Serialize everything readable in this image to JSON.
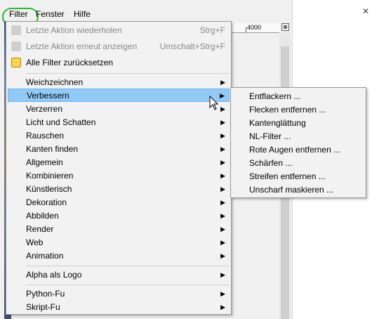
{
  "menubar": {
    "items": [
      {
        "label": "Filter"
      },
      {
        "label": "Fenster"
      },
      {
        "label": "Hilfe"
      }
    ],
    "highlight_color": "#22bb33"
  },
  "ruler": {
    "label": "4000"
  },
  "menu": {
    "top_items": [
      {
        "label": "Letzte Aktion wiederholen",
        "shortcut": "Strg+F",
        "disabled": true
      },
      {
        "label": "Letzte Aktion erneut anzeigen",
        "shortcut": "Umschalt+Strg+F",
        "disabled": true
      },
      {
        "label": "Alle Filter zurücksetzen",
        "shortcut": "",
        "disabled": false
      }
    ],
    "categories": [
      {
        "label": "Weichzeichnen"
      },
      {
        "label": "Verbessern"
      },
      {
        "label": "Verzerren"
      },
      {
        "label": "Licht und Schatten"
      },
      {
        "label": "Rauschen"
      },
      {
        "label": "Kanten finden"
      },
      {
        "label": "Allgemein"
      },
      {
        "label": "Kombinieren"
      },
      {
        "label": "Künstlerisch"
      },
      {
        "label": "Dekoration"
      },
      {
        "label": "Abbilden"
      },
      {
        "label": "Render"
      },
      {
        "label": "Web"
      },
      {
        "label": "Animation"
      }
    ],
    "logo_items": [
      {
        "label": "Alpha als Logo"
      }
    ],
    "script_items": [
      {
        "label": "Python-Fu"
      },
      {
        "label": "Skript-Fu"
      }
    ],
    "highlight_color": "#91c9f7"
  },
  "submenu": {
    "items": [
      {
        "label": "Entflackern ..."
      },
      {
        "label": "Flecken entfernen ..."
      },
      {
        "label": "Kantenglättung"
      },
      {
        "label": "NL-Filter ..."
      },
      {
        "label": "Rote Augen entfernen ..."
      },
      {
        "label": "Schärfen ..."
      },
      {
        "label": "Streifen entfernen ..."
      },
      {
        "label": "Unscharf maskieren ..."
      }
    ]
  }
}
